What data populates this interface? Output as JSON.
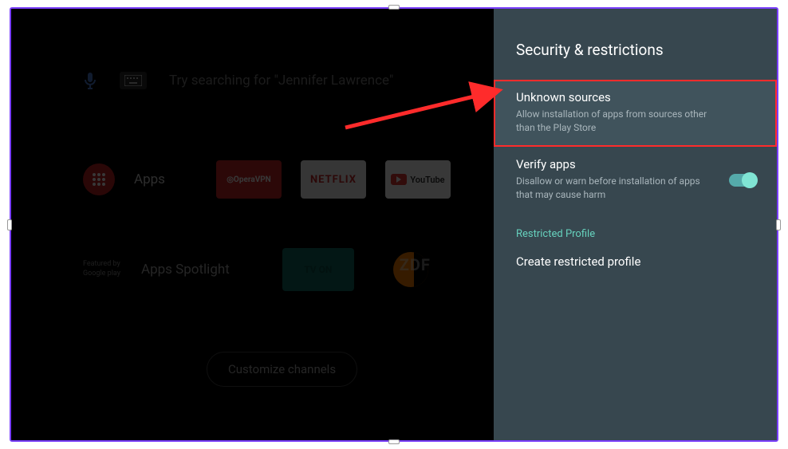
{
  "home": {
    "search_placeholder": "Try searching for \"Jennifer Lawrence\"",
    "apps_label": "Apps",
    "app_tiles": [
      "OperaVPN",
      "NETFLIX",
      "YouTube"
    ],
    "featured_by_label": "Featured by",
    "featured_by_sub": "Google play",
    "spotlight_label": "Apps Spotlight",
    "spotlight_tiles": [
      "TV ON",
      "ZDF"
    ],
    "customize_label": "Customize channels"
  },
  "settings": {
    "title": "Security & restrictions",
    "items": [
      {
        "title": "Unknown sources",
        "subtitle": "Allow installation of apps from sources other than the Play Store",
        "highlighted": true
      },
      {
        "title": "Verify apps",
        "subtitle": "Disallow or warn before installation of apps that may cause harm",
        "toggle": true
      }
    ],
    "section_label": "Restricted Profile",
    "profile_item": "Create restricted profile"
  },
  "annotation": {
    "arrow_color": "#ff2b2b"
  }
}
